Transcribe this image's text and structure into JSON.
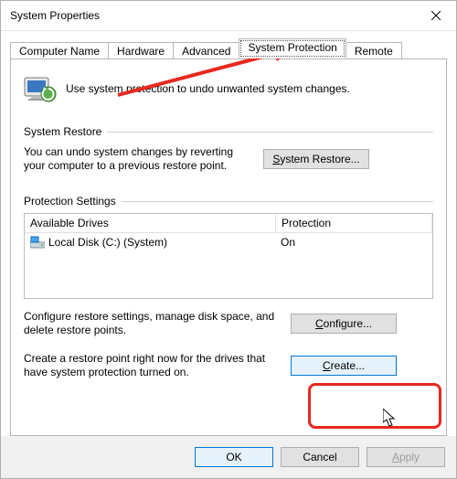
{
  "window": {
    "title": "System Properties"
  },
  "tabs": {
    "computer_name": "Computer Name",
    "hardware": "Hardware",
    "advanced": "Advanced",
    "system_protection": "System Protection",
    "remote": "Remote"
  },
  "intro_text": "Use system protection to undo unwanted system changes.",
  "system_restore": {
    "legend": "System Restore",
    "text": "You can undo system changes by reverting your computer to a previous restore point.",
    "button_prefix": "S",
    "button_rest": "ystem Restore..."
  },
  "protection_settings": {
    "legend": "Protection Settings",
    "col_drives": "Available Drives",
    "col_protection": "Protection",
    "row1_drive": "Local Disk (C:) (System)",
    "row1_protection": "On",
    "configure_text": "Configure restore settings, manage disk space, and delete restore points.",
    "configure_btn_prefix": "C",
    "configure_btn_rest": "onfigure...",
    "create_text": "Create a restore point right now for the drives that have system protection turned on.",
    "create_btn_prefix": "C",
    "create_btn_rest": "reate..."
  },
  "footer": {
    "ok": "OK",
    "cancel": "Cancel",
    "apply_prefix": "A",
    "apply_rest": "pply"
  },
  "annotation": {
    "highlight_color": "#e8281f"
  }
}
